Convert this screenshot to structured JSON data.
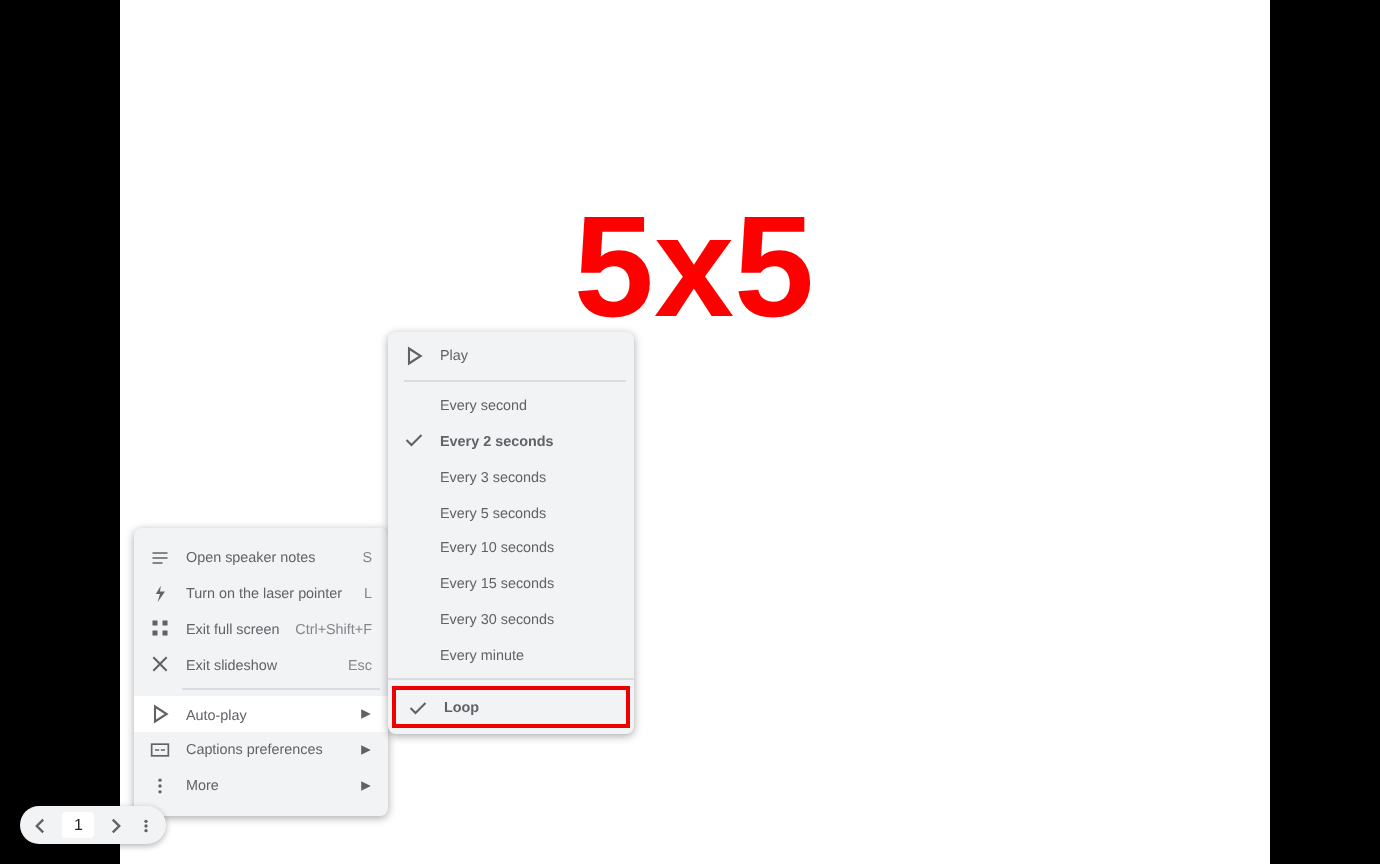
{
  "slide": {
    "title": "5x5"
  },
  "menu": {
    "items": [
      {
        "label": "Open speaker notes",
        "shortcut": "S",
        "submenu": false,
        "selected": false,
        "divider_before": false
      },
      {
        "label": "Turn on the laser pointer",
        "shortcut": "L",
        "submenu": false,
        "selected": false,
        "divider_before": false
      },
      {
        "label": "Exit full screen",
        "shortcut": "Ctrl+Shift+F",
        "submenu": false,
        "selected": false,
        "divider_before": false
      },
      {
        "label": "Exit slideshow",
        "shortcut": "Esc",
        "submenu": false,
        "selected": false,
        "divider_before": false
      },
      {
        "label": "Auto-play",
        "submenu": true,
        "selected": true,
        "divider_before": true
      },
      {
        "label": "Captions preferences",
        "submenu": true,
        "selected": false,
        "divider_before": false
      },
      {
        "label": "More",
        "submenu": true,
        "selected": false,
        "divider_before": false
      }
    ]
  },
  "autoplay_menu": {
    "play": "Play",
    "intervals": [
      {
        "label": "Every second",
        "checked": false
      },
      {
        "label": "Every 2 seconds",
        "checked": true
      },
      {
        "label": "Every 3 seconds",
        "checked": false
      },
      {
        "label": "Every 5 seconds",
        "checked": false
      },
      {
        "label": "Every 10 seconds",
        "checked": false
      },
      {
        "label": "Every 15 seconds",
        "checked": false
      },
      {
        "label": "Every 30 seconds",
        "checked": false
      },
      {
        "label": "Every minute",
        "checked": false
      }
    ],
    "loop": {
      "label": "Loop",
      "checked": true,
      "highlighted": true
    }
  },
  "navigator": {
    "page": "1"
  }
}
